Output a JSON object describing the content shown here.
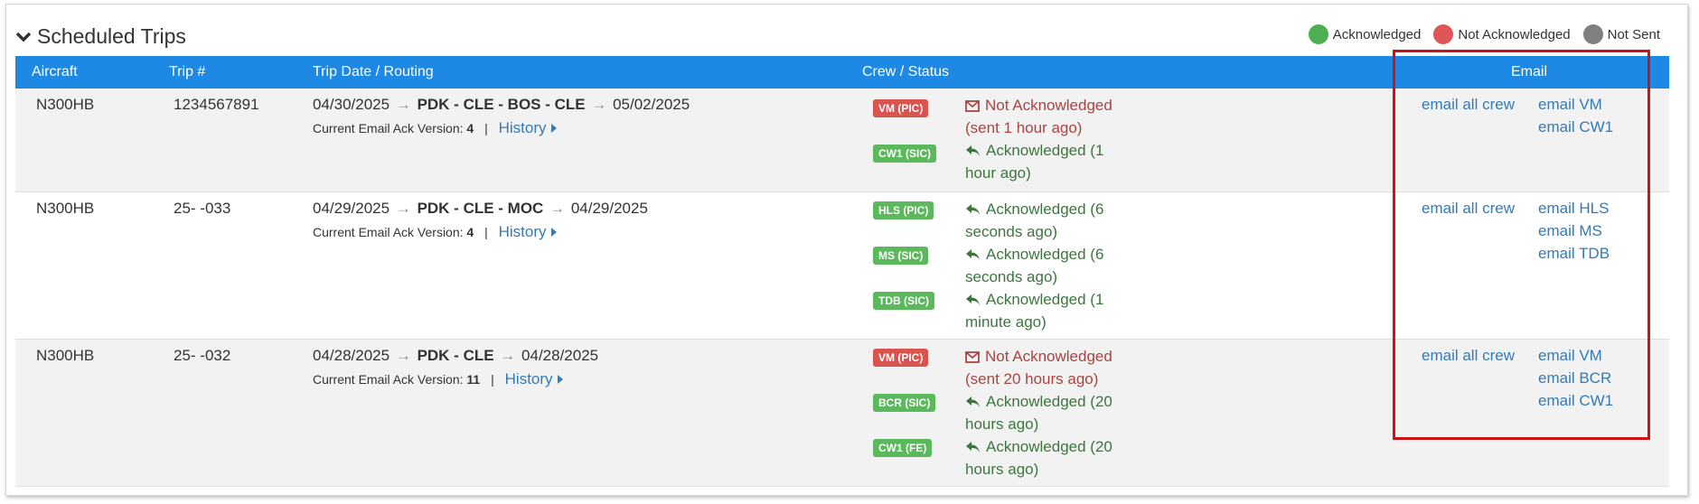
{
  "section": {
    "title": "Scheduled Trips"
  },
  "legend": [
    {
      "label": "Acknowledged",
      "color": "#4caf50"
    },
    {
      "label": "Not Acknowledged",
      "color": "#e05555"
    },
    {
      "label": "Not Sent",
      "color": "#808080"
    }
  ],
  "columns": {
    "aircraft": "Aircraft",
    "trip": "Trip #",
    "routing": "Trip Date / Routing",
    "crew": "Crew / Status",
    "email": "Email"
  },
  "labels": {
    "ack_version": "Current Email Ack Version:",
    "separator": "|",
    "history": "History",
    "email_all": "email all crew"
  },
  "rows": [
    {
      "aircraft": "N300HB",
      "trip": "1234567891",
      "start_date": "04/30/2025",
      "route": "PDK - CLE - BOS - CLE",
      "end_date": "05/02/2025",
      "ack_version": "4",
      "crew": [
        {
          "badge": "VM (PIC)",
          "state": "not_ack",
          "status": "Not Acknowledged (sent 1 hour ago)"
        },
        {
          "badge": "CW1 (SIC)",
          "state": "ack",
          "status": "Acknowledged (1 hour ago)"
        }
      ],
      "emails": [
        "email VM",
        "email CW1"
      ]
    },
    {
      "aircraft": "N300HB",
      "trip": "25- -033",
      "start_date": "04/29/2025",
      "route": "PDK - CLE - MOC",
      "end_date": "04/29/2025",
      "ack_version": "4",
      "crew": [
        {
          "badge": "HLS (PIC)",
          "state": "ack",
          "status": "Acknowledged (6 seconds ago)"
        },
        {
          "badge": "MS (SIC)",
          "state": "ack",
          "status": "Acknowledged (6 seconds ago)"
        },
        {
          "badge": "TDB (SIC)",
          "state": "ack",
          "status": "Acknowledged (1 minute ago)"
        }
      ],
      "emails": [
        "email HLS",
        "email MS",
        "email TDB"
      ]
    },
    {
      "aircraft": "N300HB",
      "trip": "25- -032",
      "start_date": "04/28/2025",
      "route": "PDK - CLE",
      "end_date": "04/28/2025",
      "ack_version": "11",
      "crew": [
        {
          "badge": "VM (PIC)",
          "state": "not_ack",
          "status": "Not Acknowledged (sent 20 hours ago)"
        },
        {
          "badge": "BCR (SIC)",
          "state": "ack",
          "status": "Acknowledged (20 hours ago)"
        },
        {
          "badge": "CW1 (FE)",
          "state": "ack",
          "status": "Acknowledged (20 hours ago)"
        }
      ],
      "emails": [
        "email VM",
        "email BCR",
        "email CW1"
      ]
    }
  ]
}
